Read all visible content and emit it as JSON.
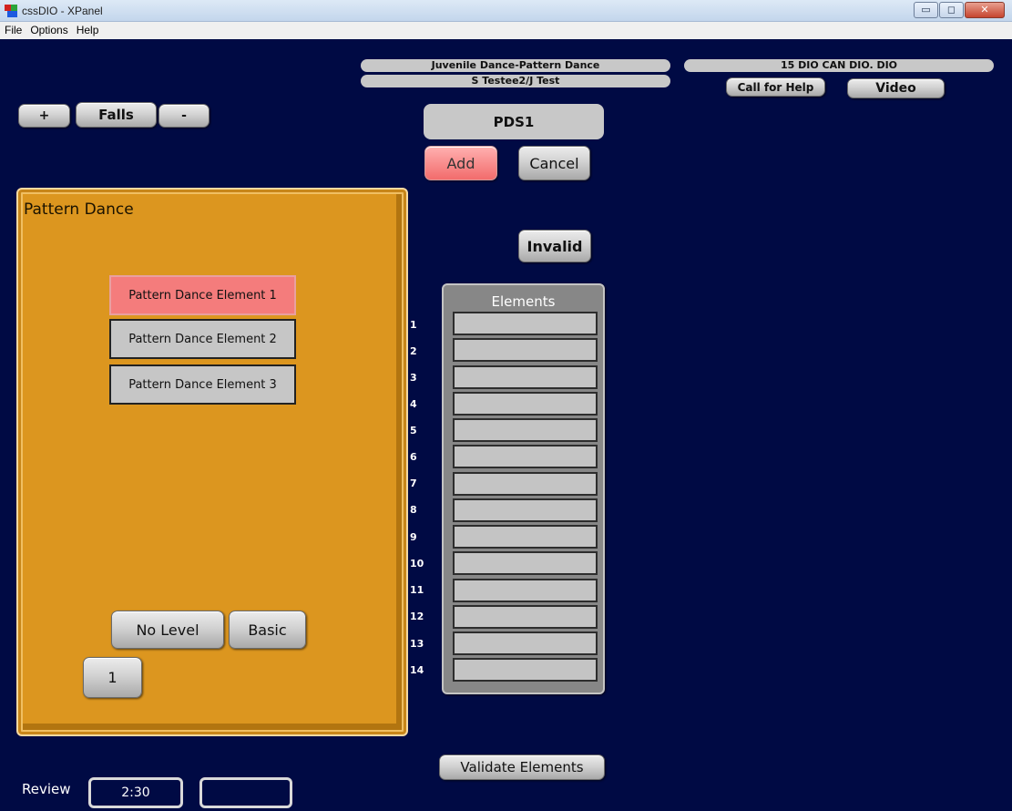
{
  "window": {
    "title": "cssDIO - XPanel",
    "minimize": "▭",
    "maximize": "◻",
    "close": "✕"
  },
  "menu": [
    "File",
    "Options",
    "Help"
  ],
  "header": {
    "event": "Juvenile Dance-Pattern Dance",
    "skaters": "S Testee2/J Test",
    "panel_id": "15 DIO CAN DIO. DIO",
    "call_help": "Call for Help",
    "video": "Video"
  },
  "falls": {
    "plus": "+",
    "label": "Falls",
    "minus": "-"
  },
  "current_element": "PDS1",
  "actions": {
    "add": "Add",
    "cancel": "Cancel",
    "invalid": "Invalid"
  },
  "pattern_panel": {
    "title": "Pattern Dance",
    "elements": [
      "Pattern Dance Element 1",
      "Pattern Dance Element 2",
      "Pattern Dance Element 3"
    ],
    "levels": [
      "No Level",
      "Basic"
    ],
    "sequence": "1"
  },
  "elements_list": {
    "title": "Elements",
    "rows": [
      "1",
      "2",
      "3",
      "4",
      "5",
      "6",
      "7",
      "8",
      "9",
      "10",
      "11",
      "12",
      "13",
      "14"
    ]
  },
  "validate": "Validate Elements",
  "review": {
    "label": "Review",
    "time": "2:30",
    "extra": ""
  },
  "colors": {
    "background": "#000a44",
    "panel": "#dc961f",
    "active": "#f47c7c",
    "button": "#d2d2d2"
  }
}
